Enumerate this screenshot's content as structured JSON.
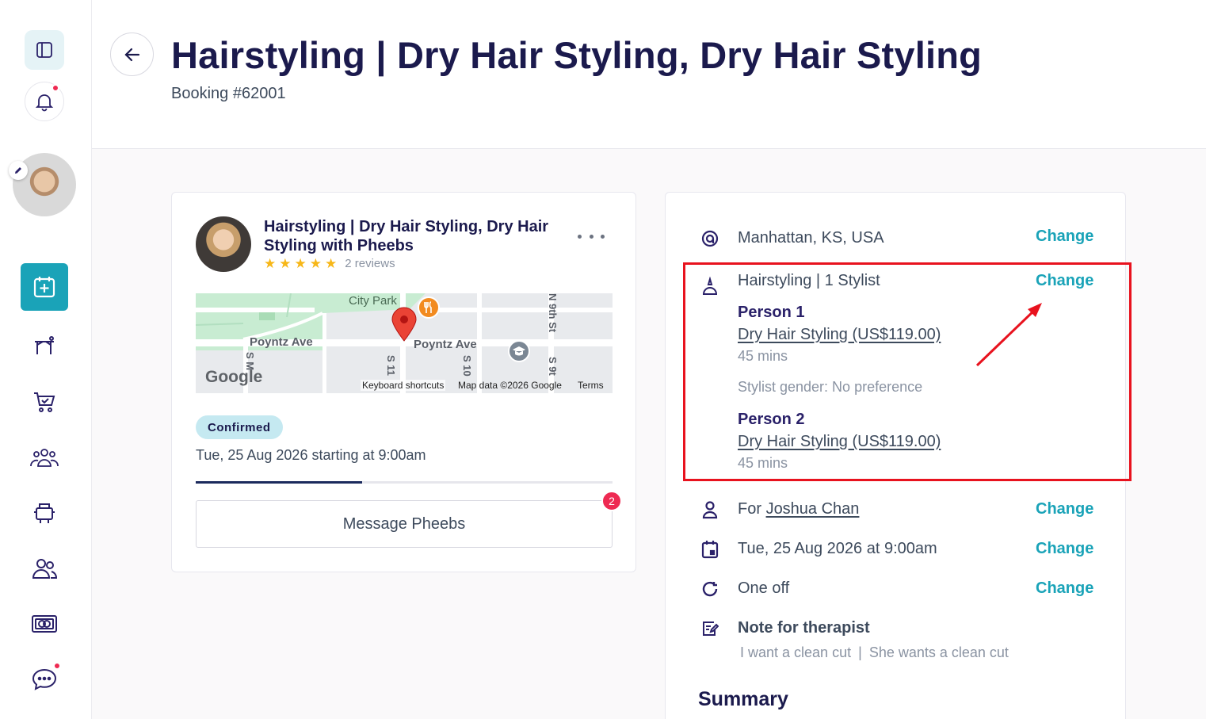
{
  "header": {
    "title": "Hairstyling | Dry Hair Styling, Dry Hair Styling",
    "booking_number": "Booking #62001"
  },
  "sidebar": {
    "bell_has_notification": true,
    "chat_has_notification": true
  },
  "pro_card": {
    "title": "Hairstyling | Dry Hair Styling, Dry Hair Styling with Pheebs",
    "rating": 5,
    "reviews": "2 reviews",
    "status": "Confirmed",
    "date_text": "Tue, 25 Aug 2026 starting at 9:00am",
    "progress": 0.4,
    "message_button": "Message Pheebs",
    "unread_messages": "2",
    "map": {
      "labels": {
        "city_park": "City Park",
        "poyntz_left": "Poyntz Ave",
        "poyntz_right": "Poyntz Ave",
        "s_11": "S 11",
        "s_10": "S 10",
        "s_9th": "S 9t",
        "n_9th": "N 9th St",
        "s_m": "S M"
      },
      "google": "Google",
      "keyboard_shortcuts": "Keyboard shortcuts",
      "map_data": "Map data ©2026 Google",
      "terms": "Terms"
    }
  },
  "details": {
    "location": "Manhattan, KS, USA",
    "service_summary": "Hairstyling | 1 Stylist",
    "person1": {
      "label": "Person 1",
      "service": "Dry Hair Styling (US$119.00)",
      "duration": "45 mins"
    },
    "stylist_gender": "Stylist gender: No preference",
    "person2": {
      "label": "Person 2",
      "service": "Dry Hair Styling (US$119.00)",
      "duration": "45 mins"
    },
    "for_prefix": "For",
    "for_name": "Joshua Chan",
    "datetime": "Tue, 25 Aug 2026 at 9:00am",
    "frequency": "One off",
    "note_title": "Note for therapist",
    "note_text": "I want a clean cut",
    "note_separator": "|",
    "note_text2": "She wants a clean cut",
    "change_label": "Change",
    "summary_title": "Summary"
  },
  "colors": {
    "accent": "#1aa3b8",
    "navy": "#1b1a4d",
    "alert": "#ee2a52",
    "annotation": "#e8121e"
  }
}
